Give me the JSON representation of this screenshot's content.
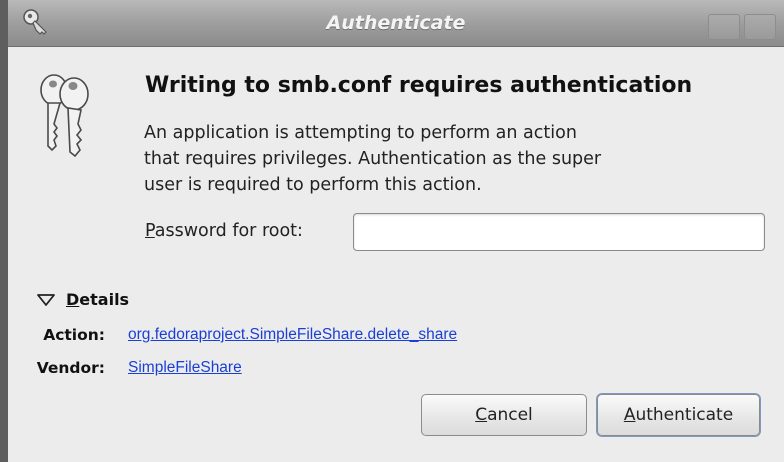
{
  "window": {
    "title": "Authenticate"
  },
  "dialog": {
    "heading": "Writing to smb.conf requires authentication",
    "description": "An application is attempting to perform an action\nthat requires privileges. Authentication as the super\nuser is required to perform this action.",
    "password_label_mnemonic": "P",
    "password_label_rest": "assword for root:",
    "password_value": ""
  },
  "details": {
    "toggle_mnemonic": "D",
    "toggle_rest": "etails",
    "action_label": "Action:",
    "action_value": "org.fedoraproject.SimpleFileShare.delete_share",
    "vendor_label": "Vendor:",
    "vendor_value": "SimpleFileShare"
  },
  "buttons": {
    "cancel_mnemonic": "C",
    "cancel_rest": "ancel",
    "authenticate_mnemonic": "A",
    "authenticate_rest": "uthenticate"
  },
  "icons": {
    "title_icon": "key-icon",
    "dialog_icon": "keys-icon",
    "details_expander": "triangle-down-icon"
  },
  "colors": {
    "link": "#1a3fd6",
    "titlebar": "#9c9c9c",
    "dialog_bg": "#ececec"
  }
}
